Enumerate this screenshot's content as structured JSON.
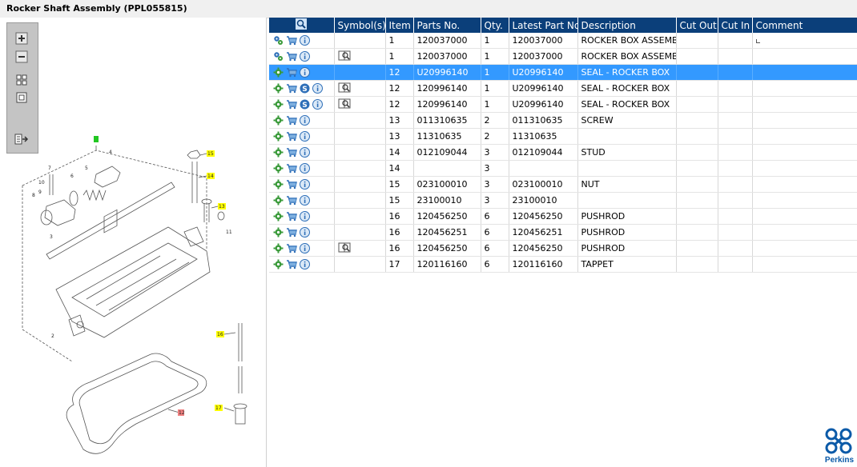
{
  "title": "Rocker Shaft Assembly (PPL055815)",
  "colors": {
    "header": "#0b3f7a",
    "selected": "#3399ff",
    "brand": "#0b5aa8"
  },
  "toolbar": {
    "buttons": [
      "zoom-in-icon",
      "zoom-out-icon",
      "fit-all-icon",
      "actual-size-icon",
      "export-icon"
    ]
  },
  "table": {
    "columns": [
      "",
      "Symbol(s)",
      "Item",
      "Parts No.",
      "Qty.",
      "Latest Part No.",
      "Description",
      "Cut Out",
      "Cut In",
      "Comment"
    ],
    "rows": [
      {
        "icons": "gears-cart-info",
        "symbol": "",
        "item": "1",
        "parts_no": "120037000",
        "qty": "1",
        "latest": "120037000",
        "desc": "ROCKER BOX ASSEMBLY",
        "selected": false
      },
      {
        "icons": "gears-cart-info",
        "symbol": "book",
        "item": "1",
        "parts_no": "120037000",
        "qty": "1",
        "latest": "120037000",
        "desc": "ROCKER BOX ASSEMBLY",
        "selected": false
      },
      {
        "icons": "gear-cart-info",
        "symbol": "",
        "item": "12",
        "parts_no": "U20996140",
        "qty": "1",
        "latest": "U20996140",
        "desc": "SEAL - ROCKER BOX",
        "selected": true
      },
      {
        "icons": "gear-cart-s-info",
        "symbol": "book",
        "item": "12",
        "parts_no": "120996140",
        "qty": "1",
        "latest": "U20996140",
        "desc": "SEAL - ROCKER BOX",
        "selected": false
      },
      {
        "icons": "gear-cart-s-info",
        "symbol": "book",
        "item": "12",
        "parts_no": "120996140",
        "qty": "1",
        "latest": "U20996140",
        "desc": "SEAL - ROCKER BOX",
        "selected": false
      },
      {
        "icons": "gear-cart-info",
        "symbol": "",
        "item": "13",
        "parts_no": "011310635",
        "qty": "2",
        "latest": "011310635",
        "desc": "SCREW",
        "selected": false
      },
      {
        "icons": "gear-cart-info",
        "symbol": "",
        "item": "13",
        "parts_no": "11310635",
        "qty": "2",
        "latest": "11310635",
        "desc": "",
        "selected": false
      },
      {
        "icons": "gear-cart-info",
        "symbol": "",
        "item": "14",
        "parts_no": "012109044",
        "qty": "3",
        "latest": "012109044",
        "desc": "STUD",
        "selected": false
      },
      {
        "icons": "gear-cart-info",
        "symbol": "",
        "item": "14",
        "parts_no": "",
        "qty": "3",
        "latest": "",
        "desc": "",
        "selected": false
      },
      {
        "icons": "gear-cart-info",
        "symbol": "",
        "item": "15",
        "parts_no": "023100010",
        "qty": "3",
        "latest": "023100010",
        "desc": "NUT",
        "selected": false
      },
      {
        "icons": "gear-cart-info",
        "symbol": "",
        "item": "15",
        "parts_no": "23100010",
        "qty": "3",
        "latest": "23100010",
        "desc": "",
        "selected": false
      },
      {
        "icons": "gear-cart-info",
        "symbol": "",
        "item": "16",
        "parts_no": "120456250",
        "qty": "6",
        "latest": "120456250",
        "desc": "PUSHROD",
        "selected": false
      },
      {
        "icons": "gear-cart-info",
        "symbol": "",
        "item": "16",
        "parts_no": "120456251",
        "qty": "6",
        "latest": "120456251",
        "desc": "PUSHROD",
        "selected": false
      },
      {
        "icons": "gear-cart-info",
        "symbol": "book",
        "item": "16",
        "parts_no": "120456250",
        "qty": "6",
        "latest": "120456250",
        "desc": "PUSHROD",
        "selected": false
      },
      {
        "icons": "gear-cart-info",
        "symbol": "",
        "item": "17",
        "parts_no": "120116160",
        "qty": "6",
        "latest": "120116160",
        "desc": "TAPPET",
        "selected": false
      }
    ]
  },
  "diagram": {
    "callouts": [
      "1",
      "2",
      "3",
      "4",
      "5",
      "6",
      "7",
      "8",
      "9",
      "10",
      "11",
      "12",
      "13",
      "14",
      "15",
      "16",
      "17"
    ]
  },
  "logo": {
    "text": "Perkins"
  }
}
